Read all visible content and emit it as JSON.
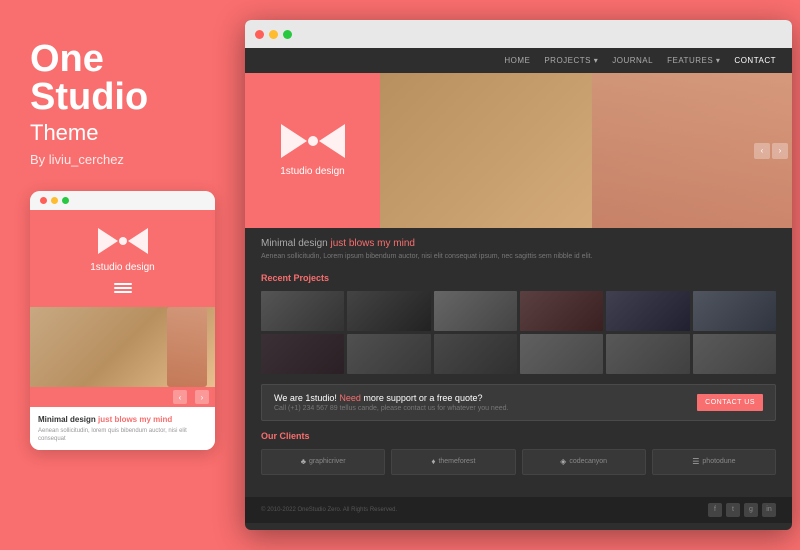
{
  "left": {
    "title_one": "One",
    "title_studio": "Studio",
    "title_theme": "Theme",
    "by_line": "By liviu_cerchez",
    "mobile": {
      "brand": "1studio design",
      "heading": "Minimal design ",
      "heading_coral": "just blows my mind",
      "body_text": "Aenean sollicitudin, lorem quis bibendum auctor, nisi elit consequat"
    }
  },
  "browser": {
    "nav": {
      "items": [
        "HOME",
        "PROJECTS ▾",
        "JOURNAL",
        "FEATURES ▾",
        "CONTACT"
      ]
    },
    "hero": {
      "brand": "1studio design"
    },
    "main": {
      "tagline_normal": "Minimal design ",
      "tagline_coral": "just blows my mind",
      "desc": "Aenean sollicitudin, Lorem ipsum bibendum auctor, nisi elit consequat ipsum, nec sagittis sem nibble id elit.",
      "recent_projects": "Recent Projects",
      "cta": {
        "text_normal": "We are 1studio! ",
        "text_coral": "Need",
        "text_normal2": " more support or a free quote?",
        "sub": "Call (+1) 234 567 89 tellus cande, please contact us for whatever you need.",
        "button": "CONTACT US"
      },
      "clients_title": "Our Clients",
      "clients": [
        {
          "icon": "♣",
          "name": "graphicriver"
        },
        {
          "icon": "♦",
          "name": "themeforest"
        },
        {
          "icon": "◈",
          "name": "codecanyon"
        },
        {
          "icon": "☰",
          "name": "photodune"
        }
      ],
      "footer_copy": "© 2010-2022 OneStudio Zero. All Rights Reserved.",
      "social_icons": [
        "f",
        "t",
        "g+",
        "in"
      ]
    }
  }
}
